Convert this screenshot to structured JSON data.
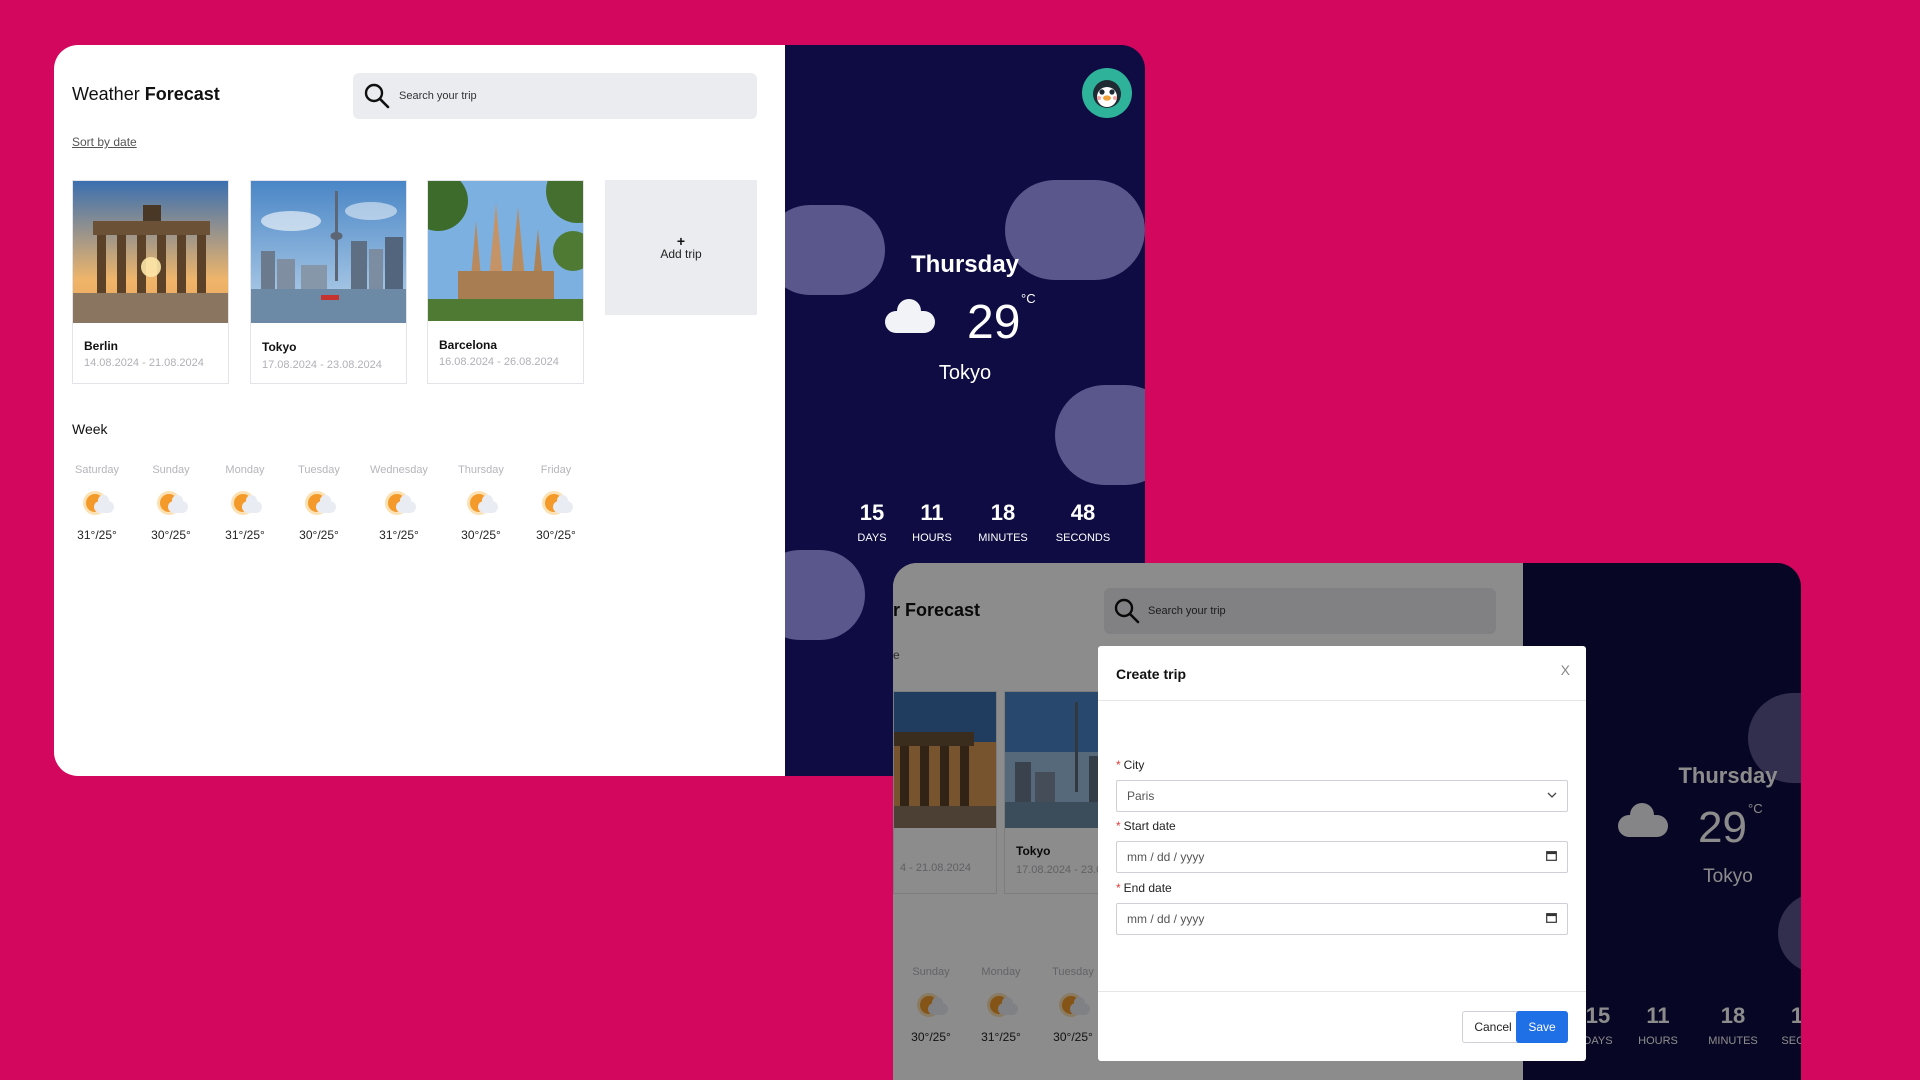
{
  "app": {
    "title_prefix": "Weather ",
    "title_bold": "Forecast",
    "search_placeholder": "Search your trip",
    "sort_label": "Sort by date",
    "add_trip_plus": "+",
    "add_trip_label": "Add trip"
  },
  "trips": [
    {
      "name": "Berlin",
      "dates": "14.08.2024 - 21.08.2024"
    },
    {
      "name": "Tokyo",
      "dates": "17.08.2024 - 23.08.2024"
    },
    {
      "name": "Barcelona",
      "dates": "16.08.2024 - 26.08.2024"
    }
  ],
  "week": {
    "title": "Week",
    "days": [
      {
        "name": "Saturday",
        "temp": "31°/25°"
      },
      {
        "name": "Sunday",
        "temp": "30°/25°"
      },
      {
        "name": "Monday",
        "temp": "31°/25°"
      },
      {
        "name": "Tuesday",
        "temp": "30°/25°"
      },
      {
        "name": "Wednesday",
        "temp": "31°/25°"
      },
      {
        "name": "Thursday",
        "temp": "30°/25°"
      },
      {
        "name": "Friday",
        "temp": "30°/25°"
      }
    ]
  },
  "current": {
    "day": "Thursday",
    "temp": "29",
    "unit": "°C",
    "city": "Tokyo"
  },
  "countdown": [
    {
      "value": "15",
      "unit": "DAYS"
    },
    {
      "value": "11",
      "unit": "HOURS"
    },
    {
      "value": "18",
      "unit": "MINUTES"
    },
    {
      "value": "48",
      "unit": "SECONDS"
    }
  ],
  "window2": {
    "title_fragment": "r Forecast",
    "sort_fragment": "e",
    "card_tokyo_name": "Tokyo",
    "card_tokyo_dates": "17.08.2024 - 23.0",
    "card_berlin_dates": "4 - 21.08.2024",
    "days": [
      {
        "name": "Sunday",
        "temp": "30°/25°"
      },
      {
        "name": "Monday",
        "temp": "31°/25°"
      },
      {
        "name": "Tuesday",
        "temp": "30°/25°"
      }
    ],
    "countdown": [
      {
        "value": "15",
        "unit": "DAYS"
      },
      {
        "value": "11",
        "unit": "HOURS"
      },
      {
        "value": "18",
        "unit": "MINUTES"
      },
      {
        "value": "1",
        "unit": "SECO"
      }
    ]
  },
  "modal": {
    "title": "Create trip",
    "close": "X",
    "required_mark": "*",
    "city_label": "City",
    "city_value": "Paris",
    "start_label": "Start date",
    "start_placeholder": "mm / dd / yyyy",
    "end_label": "End date",
    "end_placeholder": "mm / dd / yyyy",
    "cancel_label": "Cancel",
    "save_label": "Save"
  },
  "colors": {
    "background": "#d3075e",
    "panel": "#0e0c42",
    "accent": "#1f6fe6",
    "avatar": "#2fb29a"
  }
}
